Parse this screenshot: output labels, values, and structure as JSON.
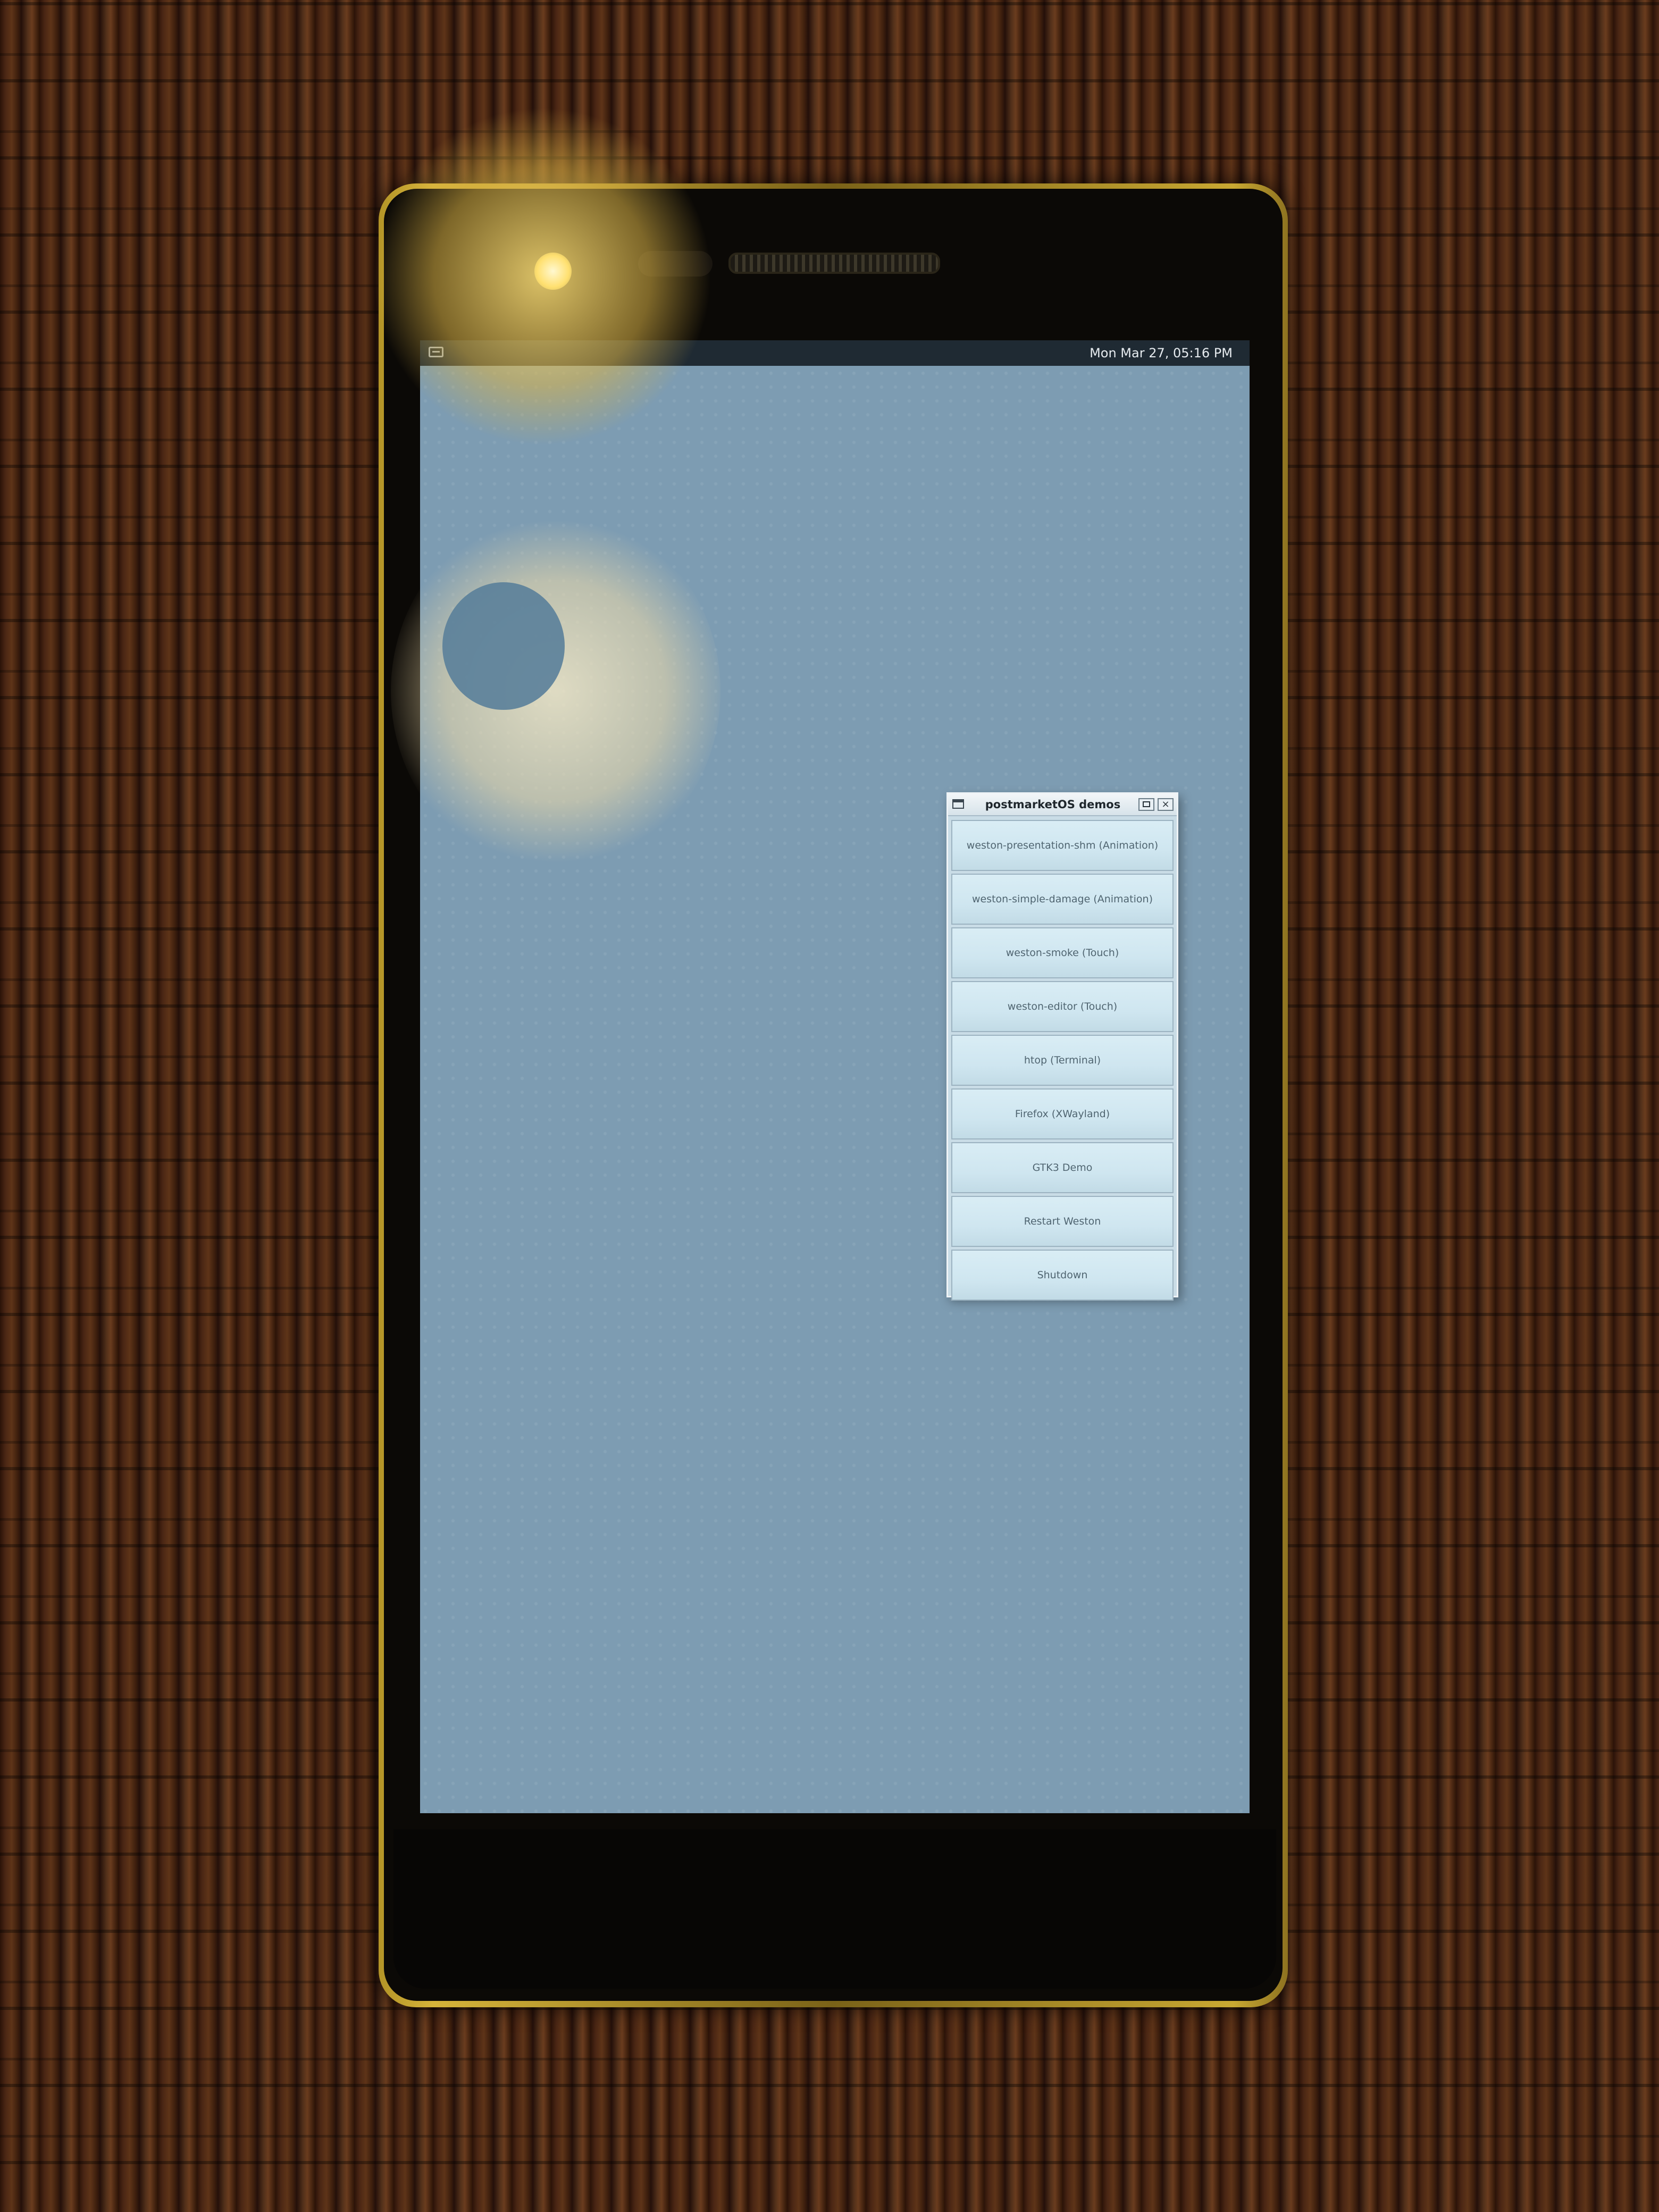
{
  "panel": {
    "clock": "Mon Mar 27, 05:16 PM",
    "launcher_icon": "terminal-icon"
  },
  "window": {
    "title": "postmarketOS demos",
    "title_icon": "window-menu-icon",
    "maximize_icon": "maximize-icon",
    "close_glyph": "×",
    "buttons": [
      {
        "label": "weston-presentation-shm (Animation)"
      },
      {
        "label": "weston-simple-damage (Animation)"
      },
      {
        "label": "weston-smoke (Touch)"
      },
      {
        "label": "weston-editor (Touch)"
      },
      {
        "label": "htop (Terminal)"
      },
      {
        "label": "Firefox (XWayland)"
      },
      {
        "label": "GTK3 Demo"
      },
      {
        "label": "Restart Weston"
      },
      {
        "label": "Shutdown"
      }
    ]
  },
  "colors": {
    "desktop_background": "#7d9cb2",
    "panel_background": "#1f2a33",
    "phone_frame": "#c9a832",
    "button_background": "#cfe6f0"
  }
}
